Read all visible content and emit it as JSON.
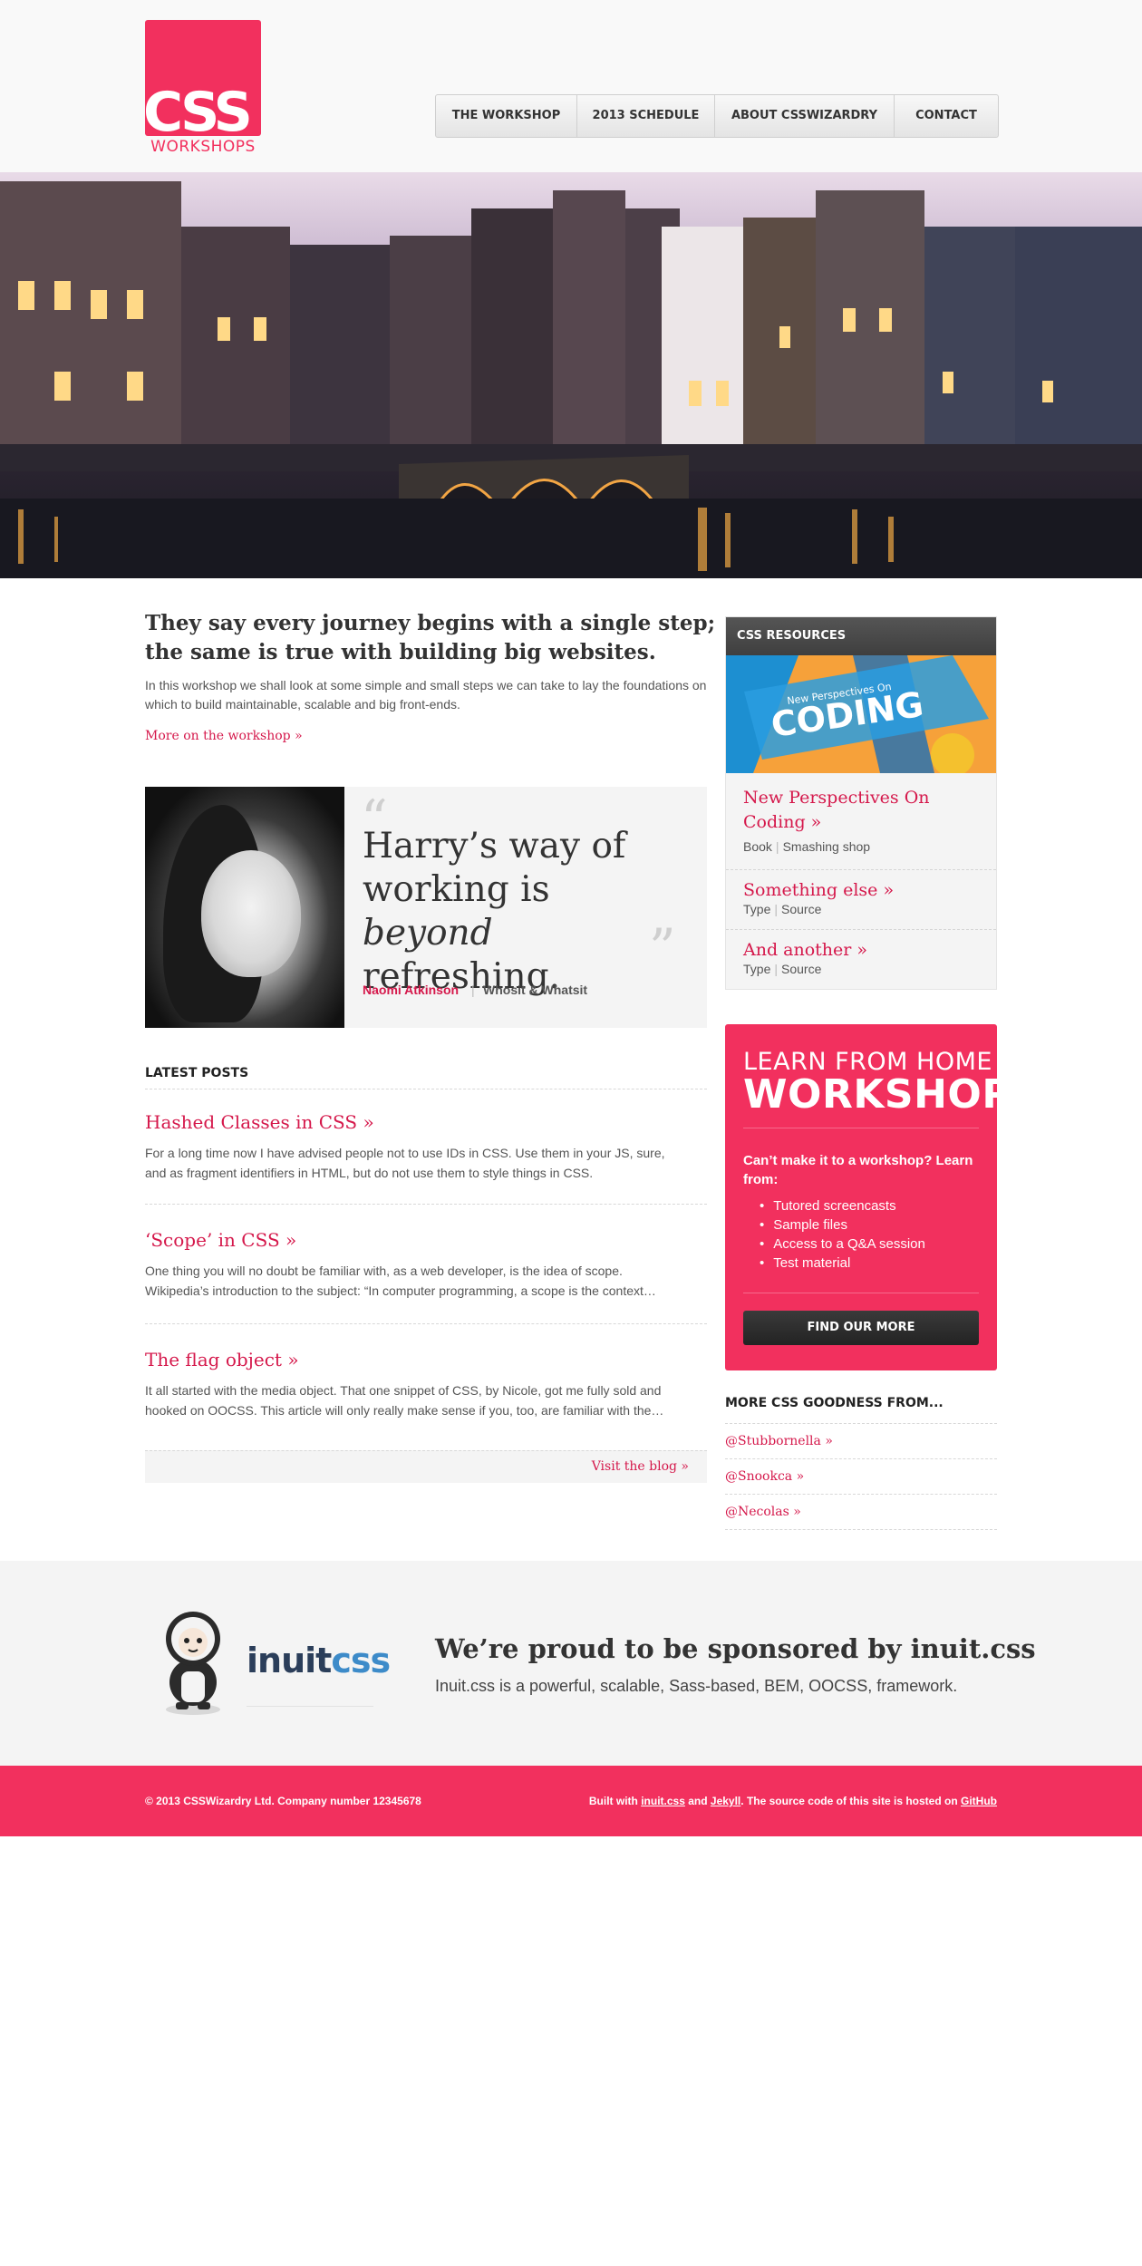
{
  "brand": {
    "logo_main": "CSS",
    "logo_sub": "WORKSHOPS",
    "accent_color": "#f2305e",
    "link_color": "#d5184b"
  },
  "nav": {
    "items": [
      {
        "label": "THE WORKSHOP"
      },
      {
        "label": "2013 SCHEDULE"
      },
      {
        "label": "ABOUT CSSWIZARDRY"
      },
      {
        "label": "CONTACT"
      }
    ]
  },
  "hero": {
    "image": "amsterdam-canal-photo"
  },
  "intro": {
    "heading": "They say every journey begins with a single step; the same is true with building big websites.",
    "body": "In this workshop we shall look at some simple and small steps we can take to lay the foundations on which to build maintainable, scalable and big front-ends.",
    "link": "More on the workshop »"
  },
  "testimonial": {
    "quote_open": "“",
    "quote_close": "”",
    "quote_start": "Harry’s way of working is ",
    "quote_em": "beyond",
    "quote_end": " refreshing.",
    "name": "Naomi Atkinson",
    "separator": "|",
    "company": "Whosit & Whatsit"
  },
  "posts": {
    "heading": "LATEST POSTS",
    "items": [
      {
        "title": "Hashed Classes in CSS »",
        "excerpt": "For a long time now I have advised people not to use IDs in CSS. Use them in your JS, sure,\nand as fragment identifiers in HTML, but do not use them to style things in CSS."
      },
      {
        "title": "‘Scope’ in CSS »",
        "excerpt": "One thing you will no doubt be familiar with, as a web developer, is the idea of scope.\nWikipedia’s introduction to the subject:  “In computer programming, a scope is the context…"
      },
      {
        "title": "The flag object »",
        "excerpt": "It all started with the media object. That one snippet of CSS, by Nicole, got me fully sold and\nhooked on OOCSS. This article will only really make sense if you, too, are familiar with the…"
      }
    ],
    "blog_link": "Visit the blog »"
  },
  "resources": {
    "heading": "CSS RESOURCES",
    "book_cover_small": "New Perspectives On",
    "book_cover_big": "CODING",
    "items": [
      {
        "title": "New Perspectives On Coding »",
        "meta1": "Book",
        "meta2": "Smashing shop"
      },
      {
        "title": "Something else »",
        "meta1": "Type",
        "meta2": "Source"
      },
      {
        "title": "And another »",
        "meta1": "Type",
        "meta2": "Source"
      }
    ]
  },
  "learn": {
    "title1": "LEARN FROM HOME",
    "title2": "WORKSHOP",
    "question": "Can’t make it to a workshop? Learn from:",
    "list": [
      "Tutored screencasts",
      "Sample files",
      "Access to a Q&A session",
      "Test material"
    ],
    "button": "FIND OUR MORE"
  },
  "more": {
    "heading": "MORE CSS GOODNESS FROM...",
    "links": [
      "@Stubbornella »",
      "@Snookca »",
      "@Necolas »"
    ]
  },
  "sponsor": {
    "logo_part1": "inuit",
    "logo_part2": "css",
    "heading": "We’re proud to be sponsored by inuit.css",
    "body": "Inuit.css is a powerful, scalable, Sass-based, BEM, OOCSS, framework."
  },
  "footer": {
    "left": "© 2013 CSSWizardry Ltd. Company number 12345678",
    "right_prefix": "Built with ",
    "link1": "inuit.css",
    "and": " and ",
    "link2": "Jekyll",
    "right_mid": ". The source code of this site is hosted on ",
    "link3": "GitHub"
  }
}
